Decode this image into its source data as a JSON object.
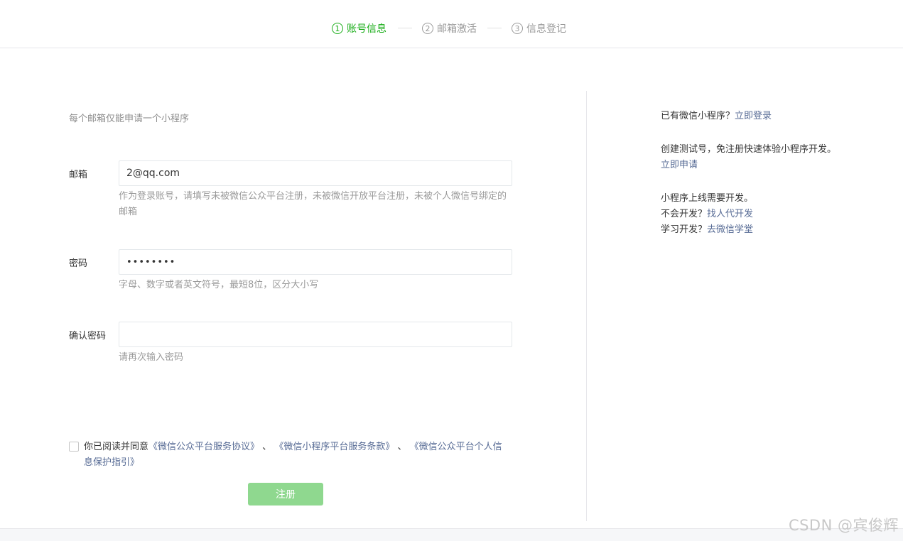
{
  "steps": [
    {
      "num": "1",
      "label": "账号信息",
      "active": true
    },
    {
      "num": "2",
      "label": "邮箱激活",
      "active": false
    },
    {
      "num": "3",
      "label": "信息登记",
      "active": false
    }
  ],
  "form": {
    "notice": "每个邮箱仅能申请一个小程序",
    "email": {
      "label": "邮箱",
      "value": "2@qq.com",
      "tip": "作为登录账号，请填写未被微信公众平台注册，未被微信开放平台注册，未被个人微信号绑定的邮箱"
    },
    "password": {
      "label": "密码",
      "value": "••••••••",
      "tip": "字母、数字或者英文符号，最短8位，区分大小写"
    },
    "confirm": {
      "label": "确认密码",
      "value": "",
      "tip": "请再次输入密码"
    },
    "agreement": {
      "prefix": "你已阅读并同意",
      "link1": "《微信公众平台服务协议》",
      "sep1": " 、",
      "link2": "《微信小程序平台服务条款》",
      "sep2": " 、",
      "link3": "《微信公众平台个人信息保护指引》",
      "checked": false
    },
    "submit_label": "注册"
  },
  "sidebar": {
    "login_prefix": "已有微信小程序？",
    "login_link": "立即登录",
    "test_text": "创建测试号，免注册快速体验小程序开发。",
    "test_link": "立即申请",
    "dev_line1": "小程序上线需要开发。",
    "dev_prefix2": "不会开发？",
    "dev_link2": "找人代开发",
    "dev_prefix3": "学习开发？",
    "dev_link3": "去微信学堂"
  },
  "watermark": "CSDN @宾俊辉",
  "colors": {
    "accent": "#1aad19",
    "link": "#576b95",
    "button_disabled": "#8fd88f"
  }
}
